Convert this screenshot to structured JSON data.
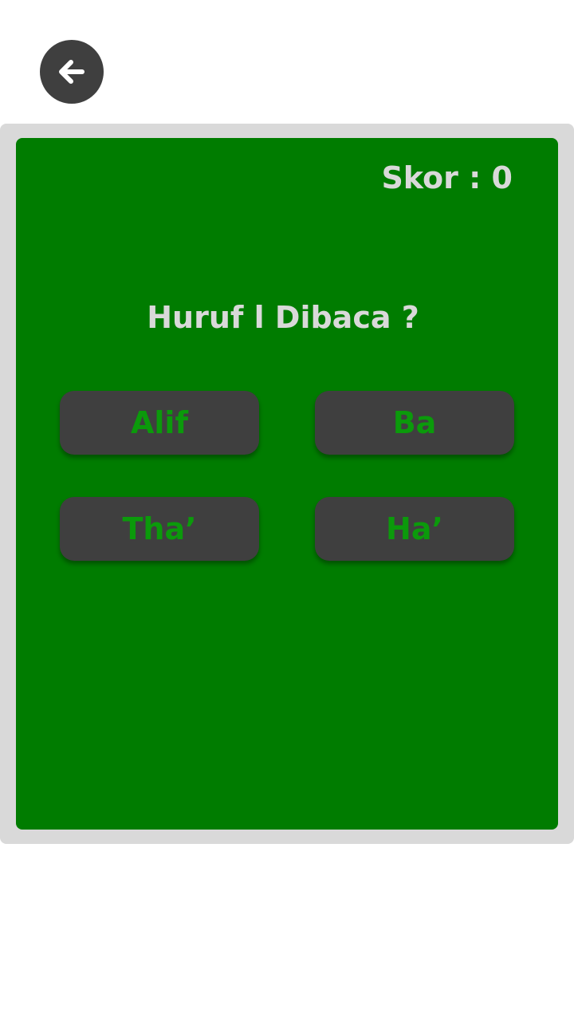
{
  "header": {
    "back_icon": "arrow-left-icon"
  },
  "quiz": {
    "score_text": "Skor : 0",
    "question": "Huruf ا Dibaca ?",
    "answers": [
      "Alif",
      "Ba",
      "Tha’",
      "Ha’"
    ]
  },
  "colors": {
    "background": "#ffffff",
    "frame": "#d9d9d9",
    "card": "#007c00",
    "button": "#3f3f3f",
    "answer_text": "#0b9a0b",
    "label_text": "#d9d9d9"
  }
}
